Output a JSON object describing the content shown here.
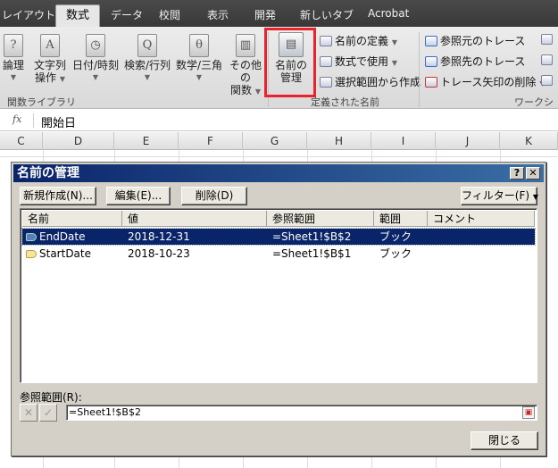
{
  "ribbon": {
    "tabs": [
      "レイアウト",
      "数式",
      "データ",
      "校閲",
      "表示",
      "開発",
      "新しいタブ",
      "Acrobat"
    ],
    "active_tab": "数式",
    "function_buttons": [
      {
        "line1": "論理",
        "line2": ""
      },
      {
        "line1": "文字列",
        "line2": "操作"
      },
      {
        "line1": "日付/時刻",
        "line2": ""
      },
      {
        "line1": "検索/行列",
        "line2": ""
      },
      {
        "line1": "数学/三角",
        "line2": ""
      },
      {
        "line1": "その他の",
        "line2": "関数"
      }
    ],
    "group_function_library": "関数ライブラリ",
    "name_manager_line1": "名前の",
    "name_manager_line2": "管理",
    "define_name": "名前の定義",
    "use_in_formula": "数式で使用",
    "create_from_selection": "選択範囲から作成",
    "group_defined_names": "定義された名前",
    "trace_precedents": "参照元のトレース",
    "trace_dependents": "参照先のトレース",
    "remove_arrows": "トレース矢印の削除",
    "group_audit": "ワークシー"
  },
  "formula_bar": {
    "fx": "fx",
    "value": "開始日"
  },
  "columns": [
    "C",
    "D",
    "E",
    "F",
    "G",
    "H",
    "I",
    "J",
    "K"
  ],
  "dialog": {
    "title": "名前の管理",
    "help": "?",
    "close": "✕",
    "new_button": "新規作成(N)...",
    "edit_button": "編集(E)...",
    "delete_button": "削除(D)",
    "filter_button": "フィルター(F)",
    "headers": [
      "名前",
      "値",
      "参照範囲",
      "範囲",
      "コメント"
    ],
    "rows": [
      {
        "name": "EndDate",
        "value": "2018-12-31",
        "refers_to": "=Sheet1!$B$2",
        "scope": "ブック",
        "comment": ""
      },
      {
        "name": "StartDate",
        "value": "2018-10-23",
        "refers_to": "=Sheet1!$B$1",
        "scope": "ブック",
        "comment": ""
      }
    ],
    "refers_to_label": "参照範囲(R):",
    "refers_to_value": "=Sheet1!$B$2",
    "cancel_glyph": "✕",
    "ok_glyph": "✓",
    "close_button": "閉じる"
  }
}
